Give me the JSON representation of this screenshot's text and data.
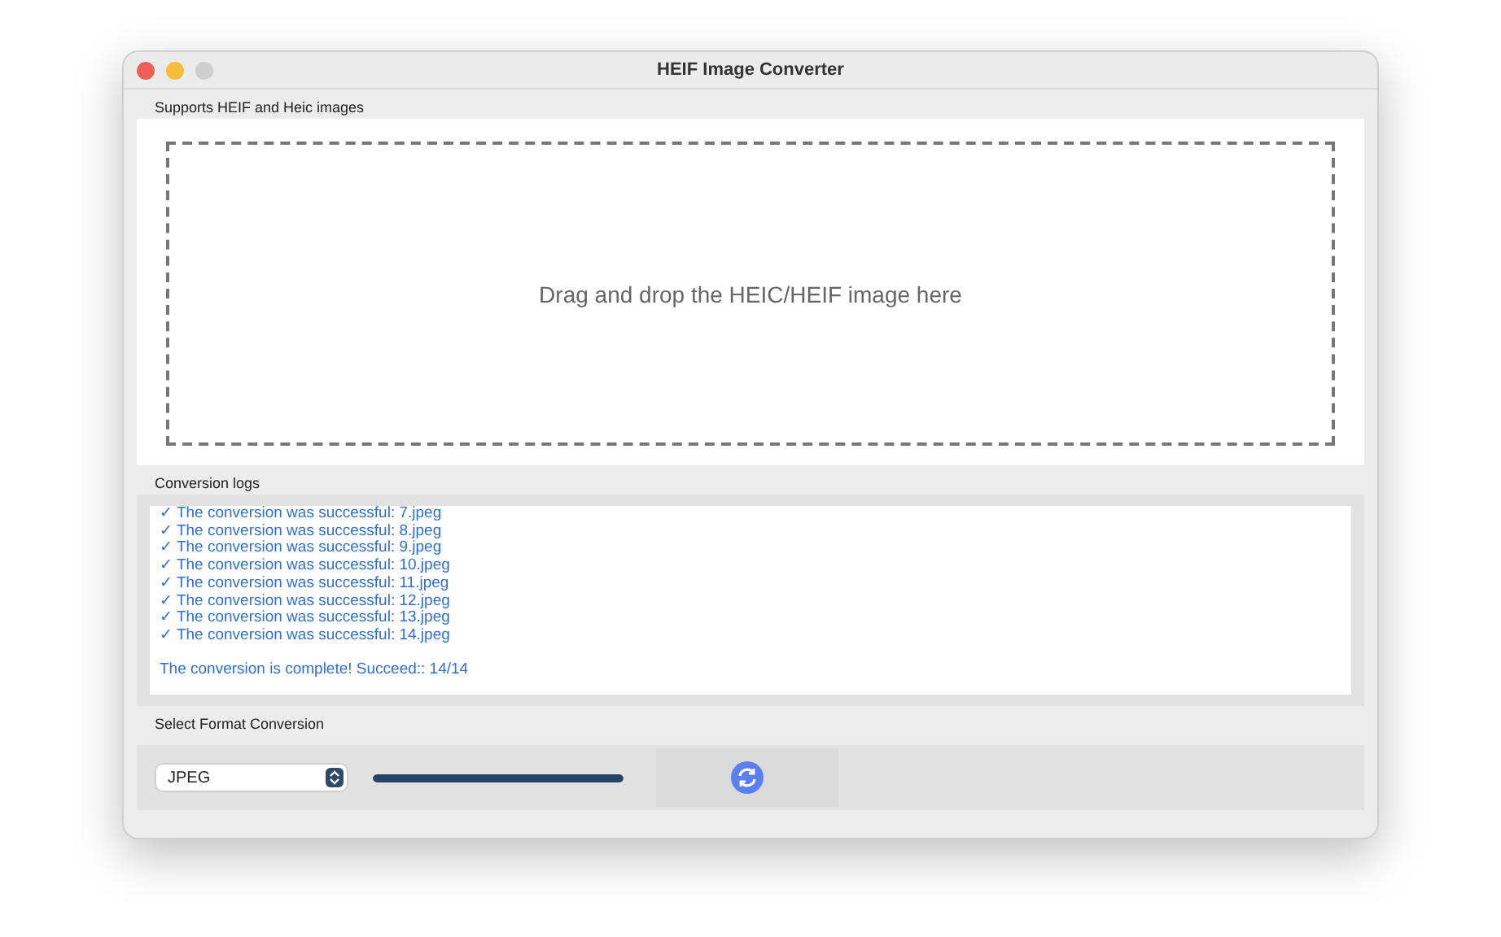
{
  "window": {
    "title": "HEIF Image Converter"
  },
  "drop_section": {
    "label": "Supports HEIF and Heic images",
    "hint": "Drag and drop the HEIC/HEIF image here"
  },
  "logs": {
    "label": "Conversion logs",
    "lines": [
      "✓ The conversion was successful: 7.jpeg",
      "✓ The conversion was successful: 8.jpeg",
      "✓ The conversion was successful: 9.jpeg",
      "✓ The conversion was successful: 10.jpeg",
      "✓ The conversion was successful: 11.jpeg",
      "✓ The conversion was successful: 12.jpeg",
      "✓ The conversion was successful: 13.jpeg",
      "✓ The conversion was successful: 14.jpeg"
    ],
    "summary": "The conversion is complete! Succeed:: 14/14"
  },
  "format_section": {
    "label": "Select Format Conversion",
    "format": "JPEG",
    "progress": {
      "level": 1
    }
  }
}
